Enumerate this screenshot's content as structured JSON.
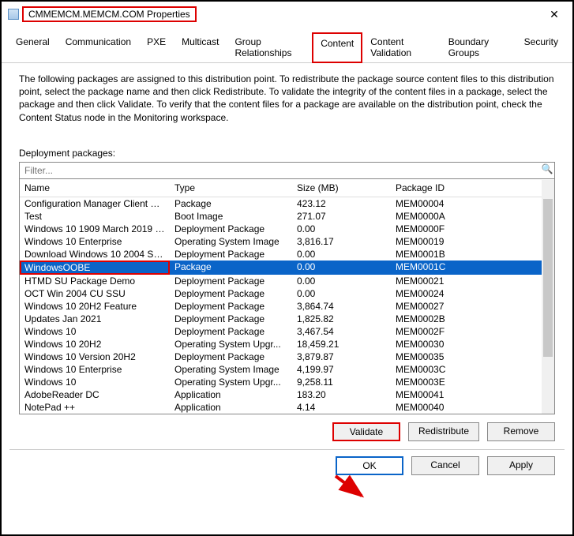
{
  "window": {
    "title": "CMMEMCM.MEMCM.COM Properties"
  },
  "tabs": [
    "General",
    "Communication",
    "PXE",
    "Multicast",
    "Group Relationships",
    "Content",
    "Content Validation",
    "Boundary Groups",
    "Security"
  ],
  "activeTab": "Content",
  "description": "The following packages are assigned to this distribution point. To redistribute the package source content files to this distribution point, select the package name and then click Redistribute. To validate the integrity of the content files in a package, select the package and then click Validate. To verify that the content files for a package are available on the distribution point, check the Content Status node in the Monitoring workspace.",
  "deploymentLabel": "Deployment packages:",
  "filterPlaceholder": "Filter...",
  "columns": {
    "name": "Name",
    "type": "Type",
    "size": "Size (MB)",
    "pid": "Package ID"
  },
  "rows": [
    {
      "name": "Configuration Manager Client Pac...",
      "type": "Package",
      "size": "423.12",
      "pid": "MEM00004"
    },
    {
      "name": "Test",
      "type": "Boot Image",
      "size": "271.07",
      "pid": "MEM0000A"
    },
    {
      "name": "Windows 10 1909 March 2019 Up...",
      "type": "Deployment Package",
      "size": "0.00",
      "pid": "MEM0000F"
    },
    {
      "name": "Windows 10 Enterprise",
      "type": "Operating System Image",
      "size": "3,816.17",
      "pid": "MEM00019"
    },
    {
      "name": "Download Windows 10 2004 Serv...",
      "type": "Deployment Package",
      "size": "0.00",
      "pid": "MEM0001B"
    },
    {
      "name": "WindowsOOBE",
      "type": "Package",
      "size": "0.00",
      "pid": "MEM0001C"
    },
    {
      "name": "HTMD SU Package Demo",
      "type": "Deployment Package",
      "size": "0.00",
      "pid": "MEM00021"
    },
    {
      "name": "OCT Win 2004 CU SSU",
      "type": "Deployment Package",
      "size": "0.00",
      "pid": "MEM00024"
    },
    {
      "name": "Windows 10 20H2 Feature",
      "type": "Deployment Package",
      "size": "3,864.74",
      "pid": "MEM00027"
    },
    {
      "name": "Updates Jan 2021",
      "type": "Deployment Package",
      "size": "1,825.82",
      "pid": "MEM0002B"
    },
    {
      "name": "Windows 10",
      "type": "Deployment Package",
      "size": "3,467.54",
      "pid": "MEM0002F"
    },
    {
      "name": "Windows 10 20H2",
      "type": "Operating System Upgr...",
      "size": "18,459.21",
      "pid": "MEM00030"
    },
    {
      "name": "Windows 10 Version 20H2",
      "type": "Deployment Package",
      "size": "3,879.87",
      "pid": "MEM00035"
    },
    {
      "name": "Windows 10 Enterprise",
      "type": "Operating System Image",
      "size": "4,199.97",
      "pid": "MEM0003C"
    },
    {
      "name": "Windows 10",
      "type": "Operating System Upgr...",
      "size": "9,258.11",
      "pid": "MEM0003E"
    },
    {
      "name": "AdobeReader DC",
      "type": "Application",
      "size": "183.20",
      "pid": "MEM00041"
    },
    {
      "name": "NotePad ++",
      "type": "Application",
      "size": "4.14",
      "pid": "MEM00040"
    }
  ],
  "selectedRow": 5,
  "buttons": {
    "validate": "Validate",
    "redistribute": "Redistribute",
    "remove": "Remove",
    "ok": "OK",
    "cancel": "Cancel",
    "apply": "Apply"
  }
}
